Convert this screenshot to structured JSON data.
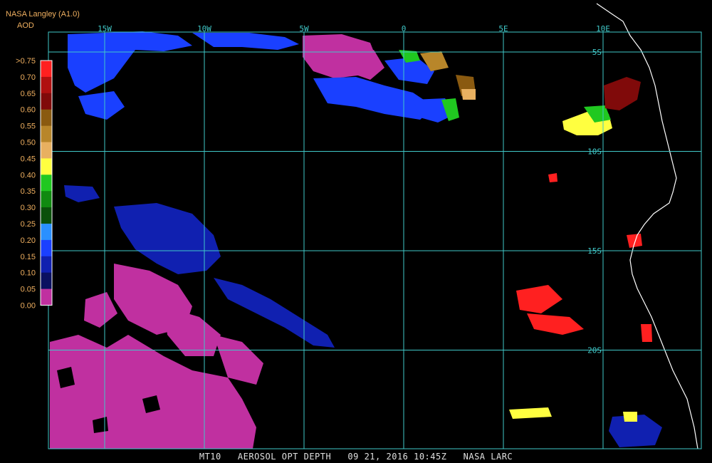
{
  "header": {
    "product": "NASA Langley (A1.0)",
    "parameter": "AOD"
  },
  "footer": {
    "caption": "MT10   AEROSOL OPT DEPTH   09 21, 2016 10:45Z   NASA LARC"
  },
  "map": {
    "lon_labels": [
      "15W",
      "10W",
      "5W",
      "0",
      "5E",
      "10E"
    ],
    "lon_values": [
      -15,
      -10,
      -5,
      0,
      5,
      10
    ],
    "lat_labels": [
      "5S",
      "10S",
      "15S",
      "20S"
    ],
    "lat_values": [
      -5,
      -10,
      -15,
      -20
    ],
    "grid_color": "#40c8c8",
    "coast_color": "#ffffff",
    "background": "#000000"
  },
  "legend": {
    "labels": [
      ">0.75",
      "0.70",
      "0.65",
      "0.60",
      "0.55",
      "0.50",
      "0.45",
      "0.40",
      "0.35",
      "0.30",
      "0.25",
      "0.20",
      "0.15",
      "0.10",
      "0.05",
      "0.00"
    ],
    "colors": [
      "#ff2020",
      "#b01010",
      "#800a0a",
      "#8a5a10",
      "#b8862a",
      "#e8b060",
      "#ffff40",
      "#20c820",
      "#108a10",
      "#0a500a",
      "#2a90ff",
      "#1a40ff",
      "#1020b0",
      "#0a1060",
      "#c030a0"
    ],
    "label_color": "#f0b060"
  },
  "aerosol_regions": [
    {
      "name": "ocean-clean-southwest",
      "aod": 0.0,
      "color": "#c030a0"
    },
    {
      "name": "ocean-clean-north",
      "aod": 0.0,
      "color": "#c030a0"
    },
    {
      "name": "ocean-low-northwest",
      "aod": 0.15,
      "color": "#1a40ff"
    },
    {
      "name": "ocean-low-central",
      "aod": 0.15,
      "color": "#1a40ff"
    },
    {
      "name": "smoke-plume-angola",
      "aod": 0.45,
      "color": "#ffff40"
    },
    {
      "name": "smoke-high-angola",
      "aod": 0.7,
      "color": "#b01010"
    },
    {
      "name": "smoke-offshore-namibia",
      "aod": 0.75,
      "color": "#ff2020"
    }
  ]
}
